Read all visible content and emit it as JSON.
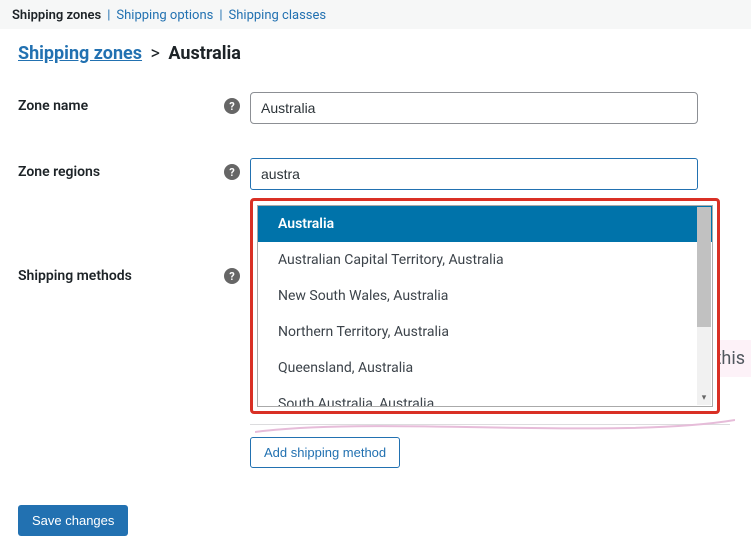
{
  "tabs": {
    "zones": "Shipping zones",
    "options": "Shipping options",
    "classes": "Shipping classes"
  },
  "breadcrumb": {
    "root": "Shipping zones",
    "arrow": ">",
    "current": "Australia"
  },
  "labels": {
    "zone_name": "Zone name",
    "zone_regions": "Zone regions",
    "shipping_methods": "Shipping methods"
  },
  "fields": {
    "zone_name_value": "Australia",
    "regions_query": "austra"
  },
  "dropdown": {
    "options": [
      "Australia",
      "Australian Capital Territory, Australia",
      "New South Wales, Australia",
      "Northern Territory, Australia",
      "Queensland, Australia",
      "South Australia, Australia"
    ],
    "highlighted_index": 0
  },
  "methods": {
    "hint_fragment": "n this",
    "add_button": "Add shipping method"
  },
  "buttons": {
    "save": "Save changes"
  },
  "help_glyph": "?"
}
